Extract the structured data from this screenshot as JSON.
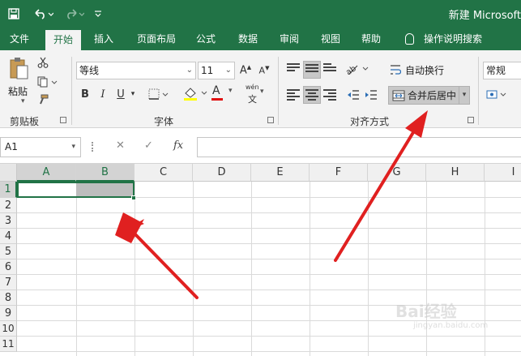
{
  "titlebar": {
    "title": "新建 Microsoft"
  },
  "tabs": [
    {
      "label": "文件"
    },
    {
      "label": "开始"
    },
    {
      "label": "插入"
    },
    {
      "label": "页面布局"
    },
    {
      "label": "公式"
    },
    {
      "label": "数据"
    },
    {
      "label": "审阅"
    },
    {
      "label": "视图"
    },
    {
      "label": "帮助"
    }
  ],
  "tellme": {
    "label": "操作说明搜索"
  },
  "ribbon": {
    "clipboard": {
      "paste_label": "粘贴",
      "group_label": "剪贴板"
    },
    "font": {
      "font_name": "等线",
      "font_size": "11",
      "bold": "B",
      "italic": "I",
      "underline": "U",
      "font_color_glyph": "A",
      "phonetic_glyph": "wén",
      "group_label": "字体"
    },
    "alignment": {
      "wrap_label": "自动换行",
      "merge_label": "合并后居中",
      "group_label": "对齐方式"
    },
    "number": {
      "format": "常规"
    }
  },
  "formula_bar": {
    "name_box": "A1",
    "fx": "fx",
    "cancel": "✕",
    "enter": "✓"
  },
  "grid": {
    "columns": [
      "A",
      "B",
      "C",
      "D",
      "E",
      "F",
      "G",
      "H",
      "I"
    ],
    "rows": [
      "1",
      "2",
      "3",
      "4",
      "5",
      "6",
      "7",
      "8",
      "9",
      "10",
      "11"
    ]
  },
  "watermark": {
    "brand": "Bai经验",
    "sub": "jingyan.baidu.com"
  },
  "colors": {
    "excel_green": "#217346",
    "arrow_red": "#e02020"
  }
}
